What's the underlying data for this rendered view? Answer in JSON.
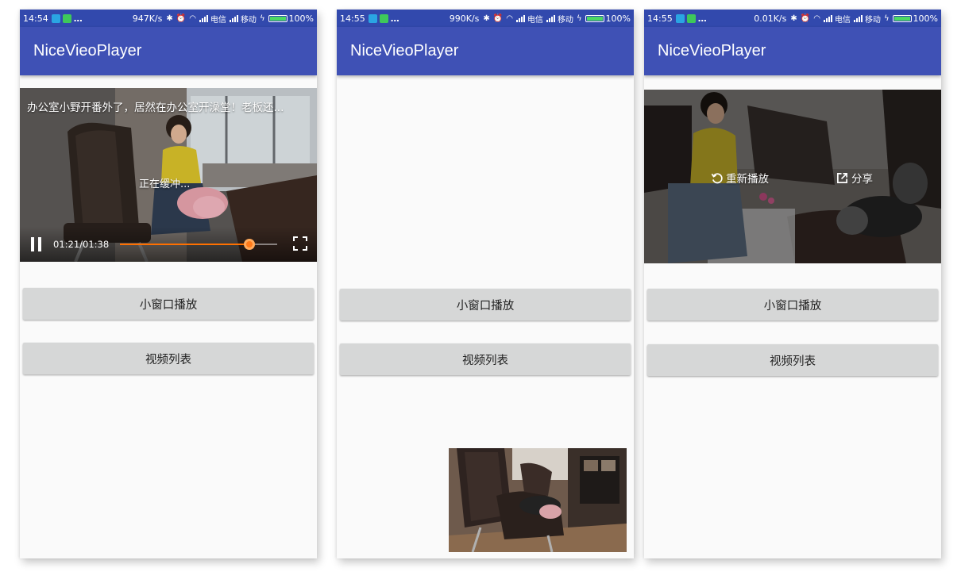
{
  "screens": [
    {
      "status": {
        "time": "14:54",
        "speed": "947K/s",
        "carrier1": "电信",
        "carrier2": "移动",
        "battery": "100%"
      },
      "app_title": "NiceVieoPlayer",
      "video": {
        "title": "办公室小野开番外了，居然在办公室开澡堂！老板还...",
        "loading_text": "正在缓冲...",
        "time": "01:21/01:38",
        "progress": 0.824
      },
      "buttons": {
        "small_window": "小窗口播放",
        "video_list": "视频列表"
      }
    },
    {
      "status": {
        "time": "14:55",
        "speed": "990K/s",
        "carrier1": "电信",
        "carrier2": "移动",
        "battery": "100%"
      },
      "app_title": "NiceVieoPlayer",
      "buttons": {
        "small_window": "小窗口播放",
        "video_list": "视频列表"
      }
    },
    {
      "status": {
        "time": "14:55",
        "speed": "0.01K/s",
        "carrier1": "电信",
        "carrier2": "移动",
        "battery": "100%"
      },
      "app_title": "NiceVieoPlayer",
      "completed": {
        "replay_label": "重新播放",
        "share_label": "分享"
      },
      "buttons": {
        "small_window": "小窗口播放",
        "video_list": "视频列表"
      }
    }
  ],
  "colors": {
    "status_bar": "#3249ad",
    "app_bar": "#3f51b5",
    "button": "#d6d7d7",
    "progress_accent": "#ff7000"
  }
}
